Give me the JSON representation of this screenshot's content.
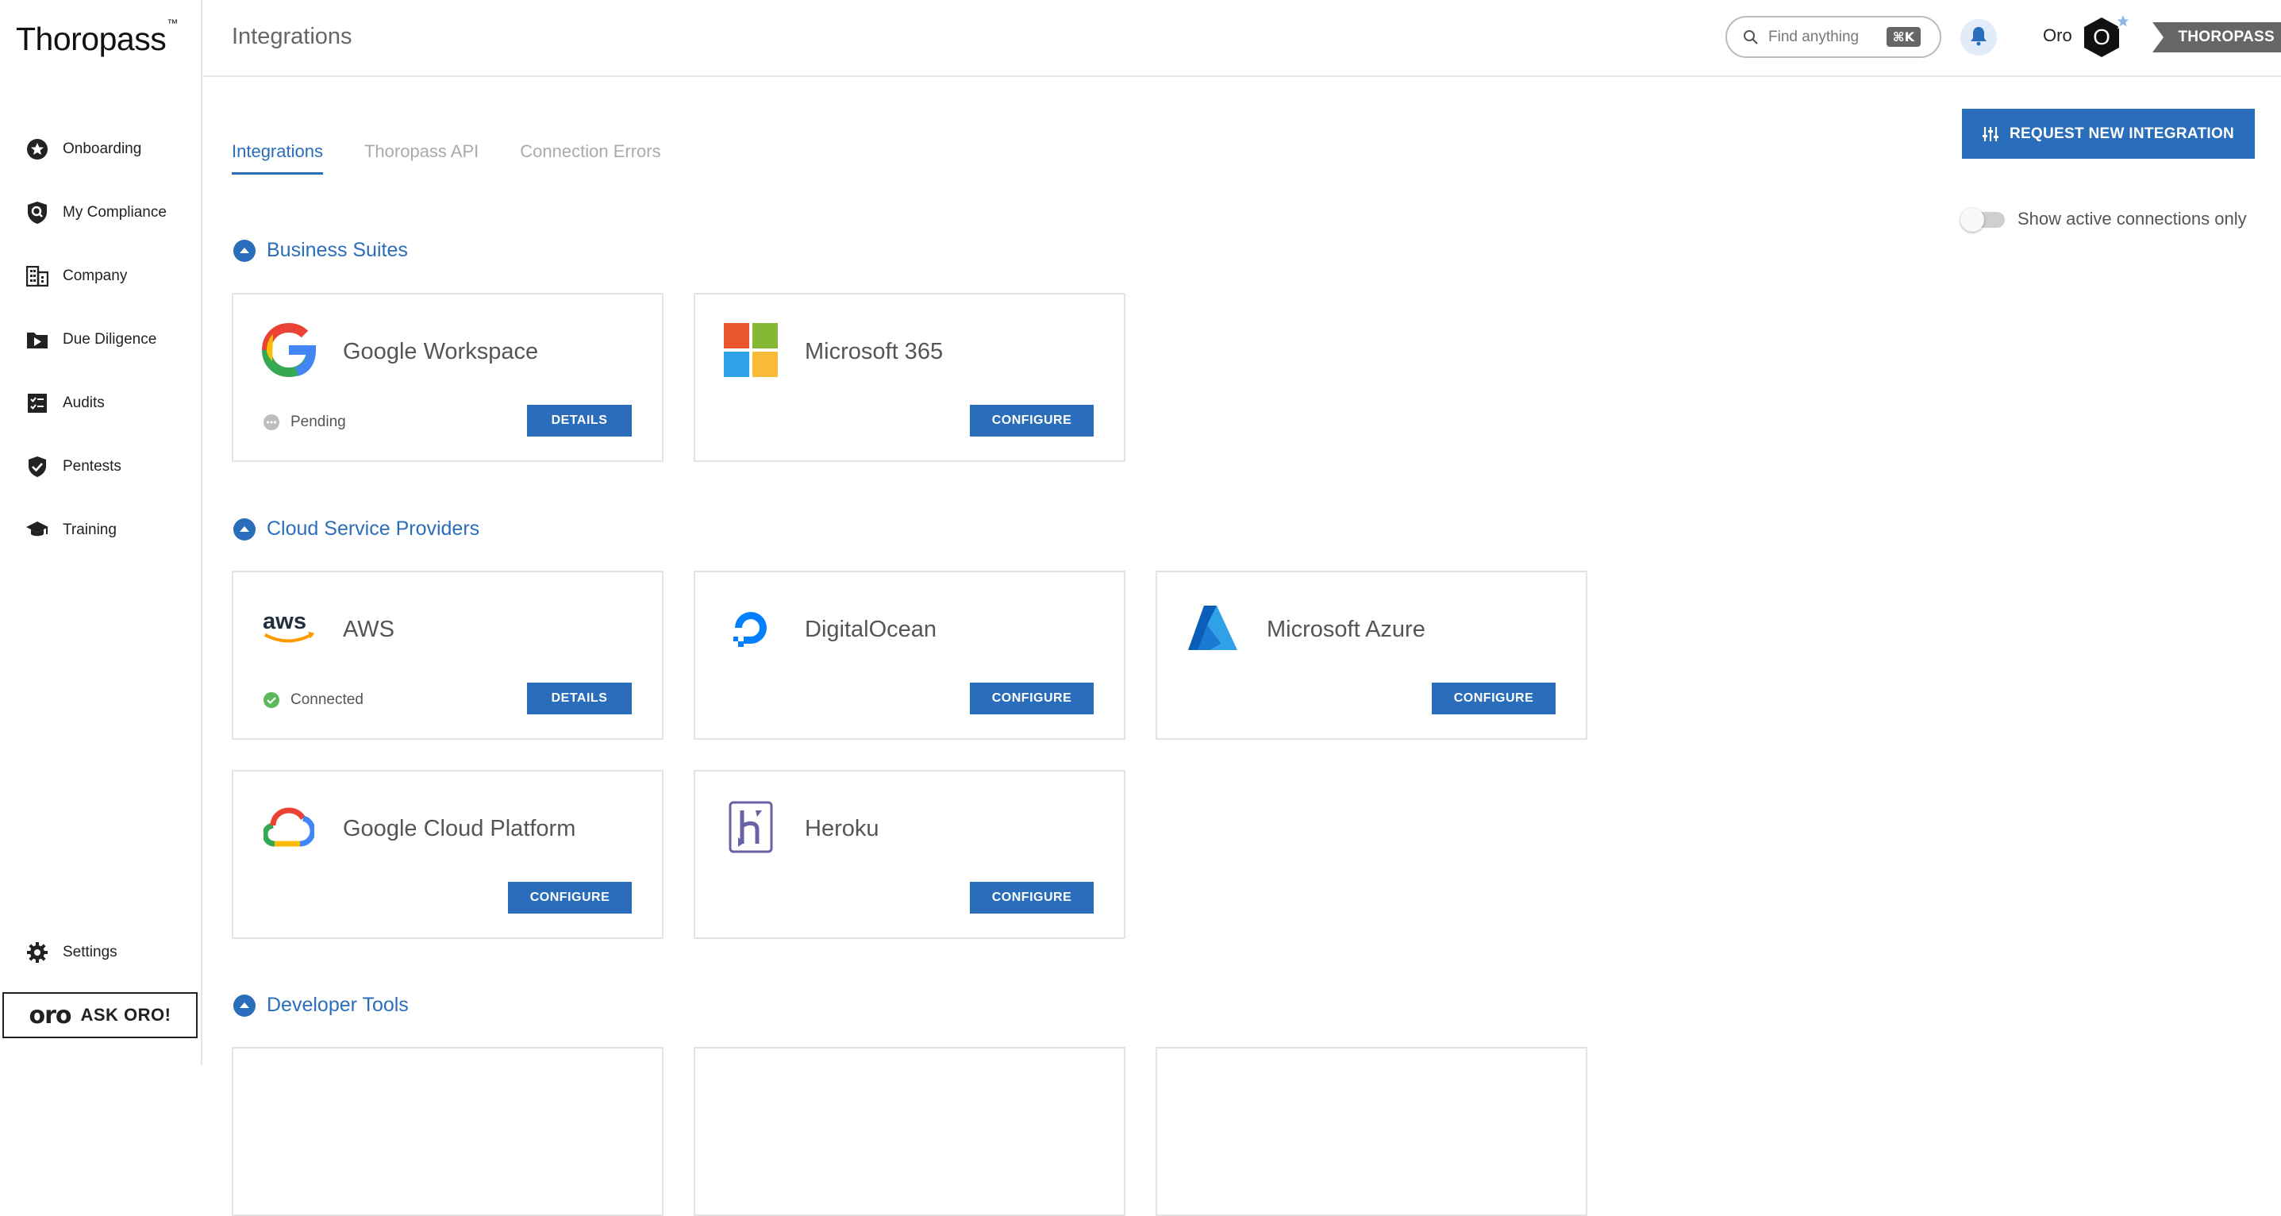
{
  "brand": {
    "name": "Thoropass",
    "tm": "™"
  },
  "sidebar": {
    "items": [
      {
        "label": "Onboarding",
        "icon": "star-badge-icon"
      },
      {
        "label": "My Compliance",
        "icon": "shield-search-icon"
      },
      {
        "label": "Company",
        "icon": "building-icon"
      },
      {
        "label": "Due Diligence",
        "icon": "folder-arrow-icon"
      },
      {
        "label": "Audits",
        "icon": "checklist-icon"
      },
      {
        "label": "Pentests",
        "icon": "shield-check-icon"
      },
      {
        "label": "Training",
        "icon": "graduation-cap-icon"
      }
    ],
    "settings_label": "Settings",
    "ask_oro": {
      "mark": "oro",
      "label": "ASK ORO!"
    }
  },
  "header": {
    "title": "Integrations",
    "search_placeholder": "Find anything",
    "search_shortcut": "⌘K",
    "user_name": "Oro",
    "avatar_initial": "O",
    "org": "THOROPASS"
  },
  "tabs": [
    {
      "label": "Integrations",
      "active": true
    },
    {
      "label": "Thoropass API",
      "active": false
    },
    {
      "label": "Connection Errors",
      "active": false
    }
  ],
  "request_button": "REQUEST NEW INTEGRATION",
  "toggle_label": "Show active connections only",
  "sections": [
    {
      "title": "Business Suites",
      "cards": [
        {
          "name": "Google Workspace",
          "status": "Pending",
          "button": "DETAILS"
        },
        {
          "name": "Microsoft 365",
          "button": "CONFIGURE"
        }
      ]
    },
    {
      "title": "Cloud Service Providers",
      "cards": [
        {
          "name": "AWS",
          "status": "Connected",
          "button": "DETAILS"
        },
        {
          "name": "DigitalOcean",
          "button": "CONFIGURE"
        },
        {
          "name": "Microsoft Azure",
          "button": "CONFIGURE"
        },
        {
          "name": "Google Cloud Platform",
          "button": "CONFIGURE"
        },
        {
          "name": "Heroku",
          "button": "CONFIGURE"
        }
      ]
    },
    {
      "title": "Developer Tools",
      "cards": []
    }
  ],
  "colors": {
    "accent": "#2a6ebb",
    "connected": "#5cb85c",
    "pending": "#bdbdbd"
  }
}
